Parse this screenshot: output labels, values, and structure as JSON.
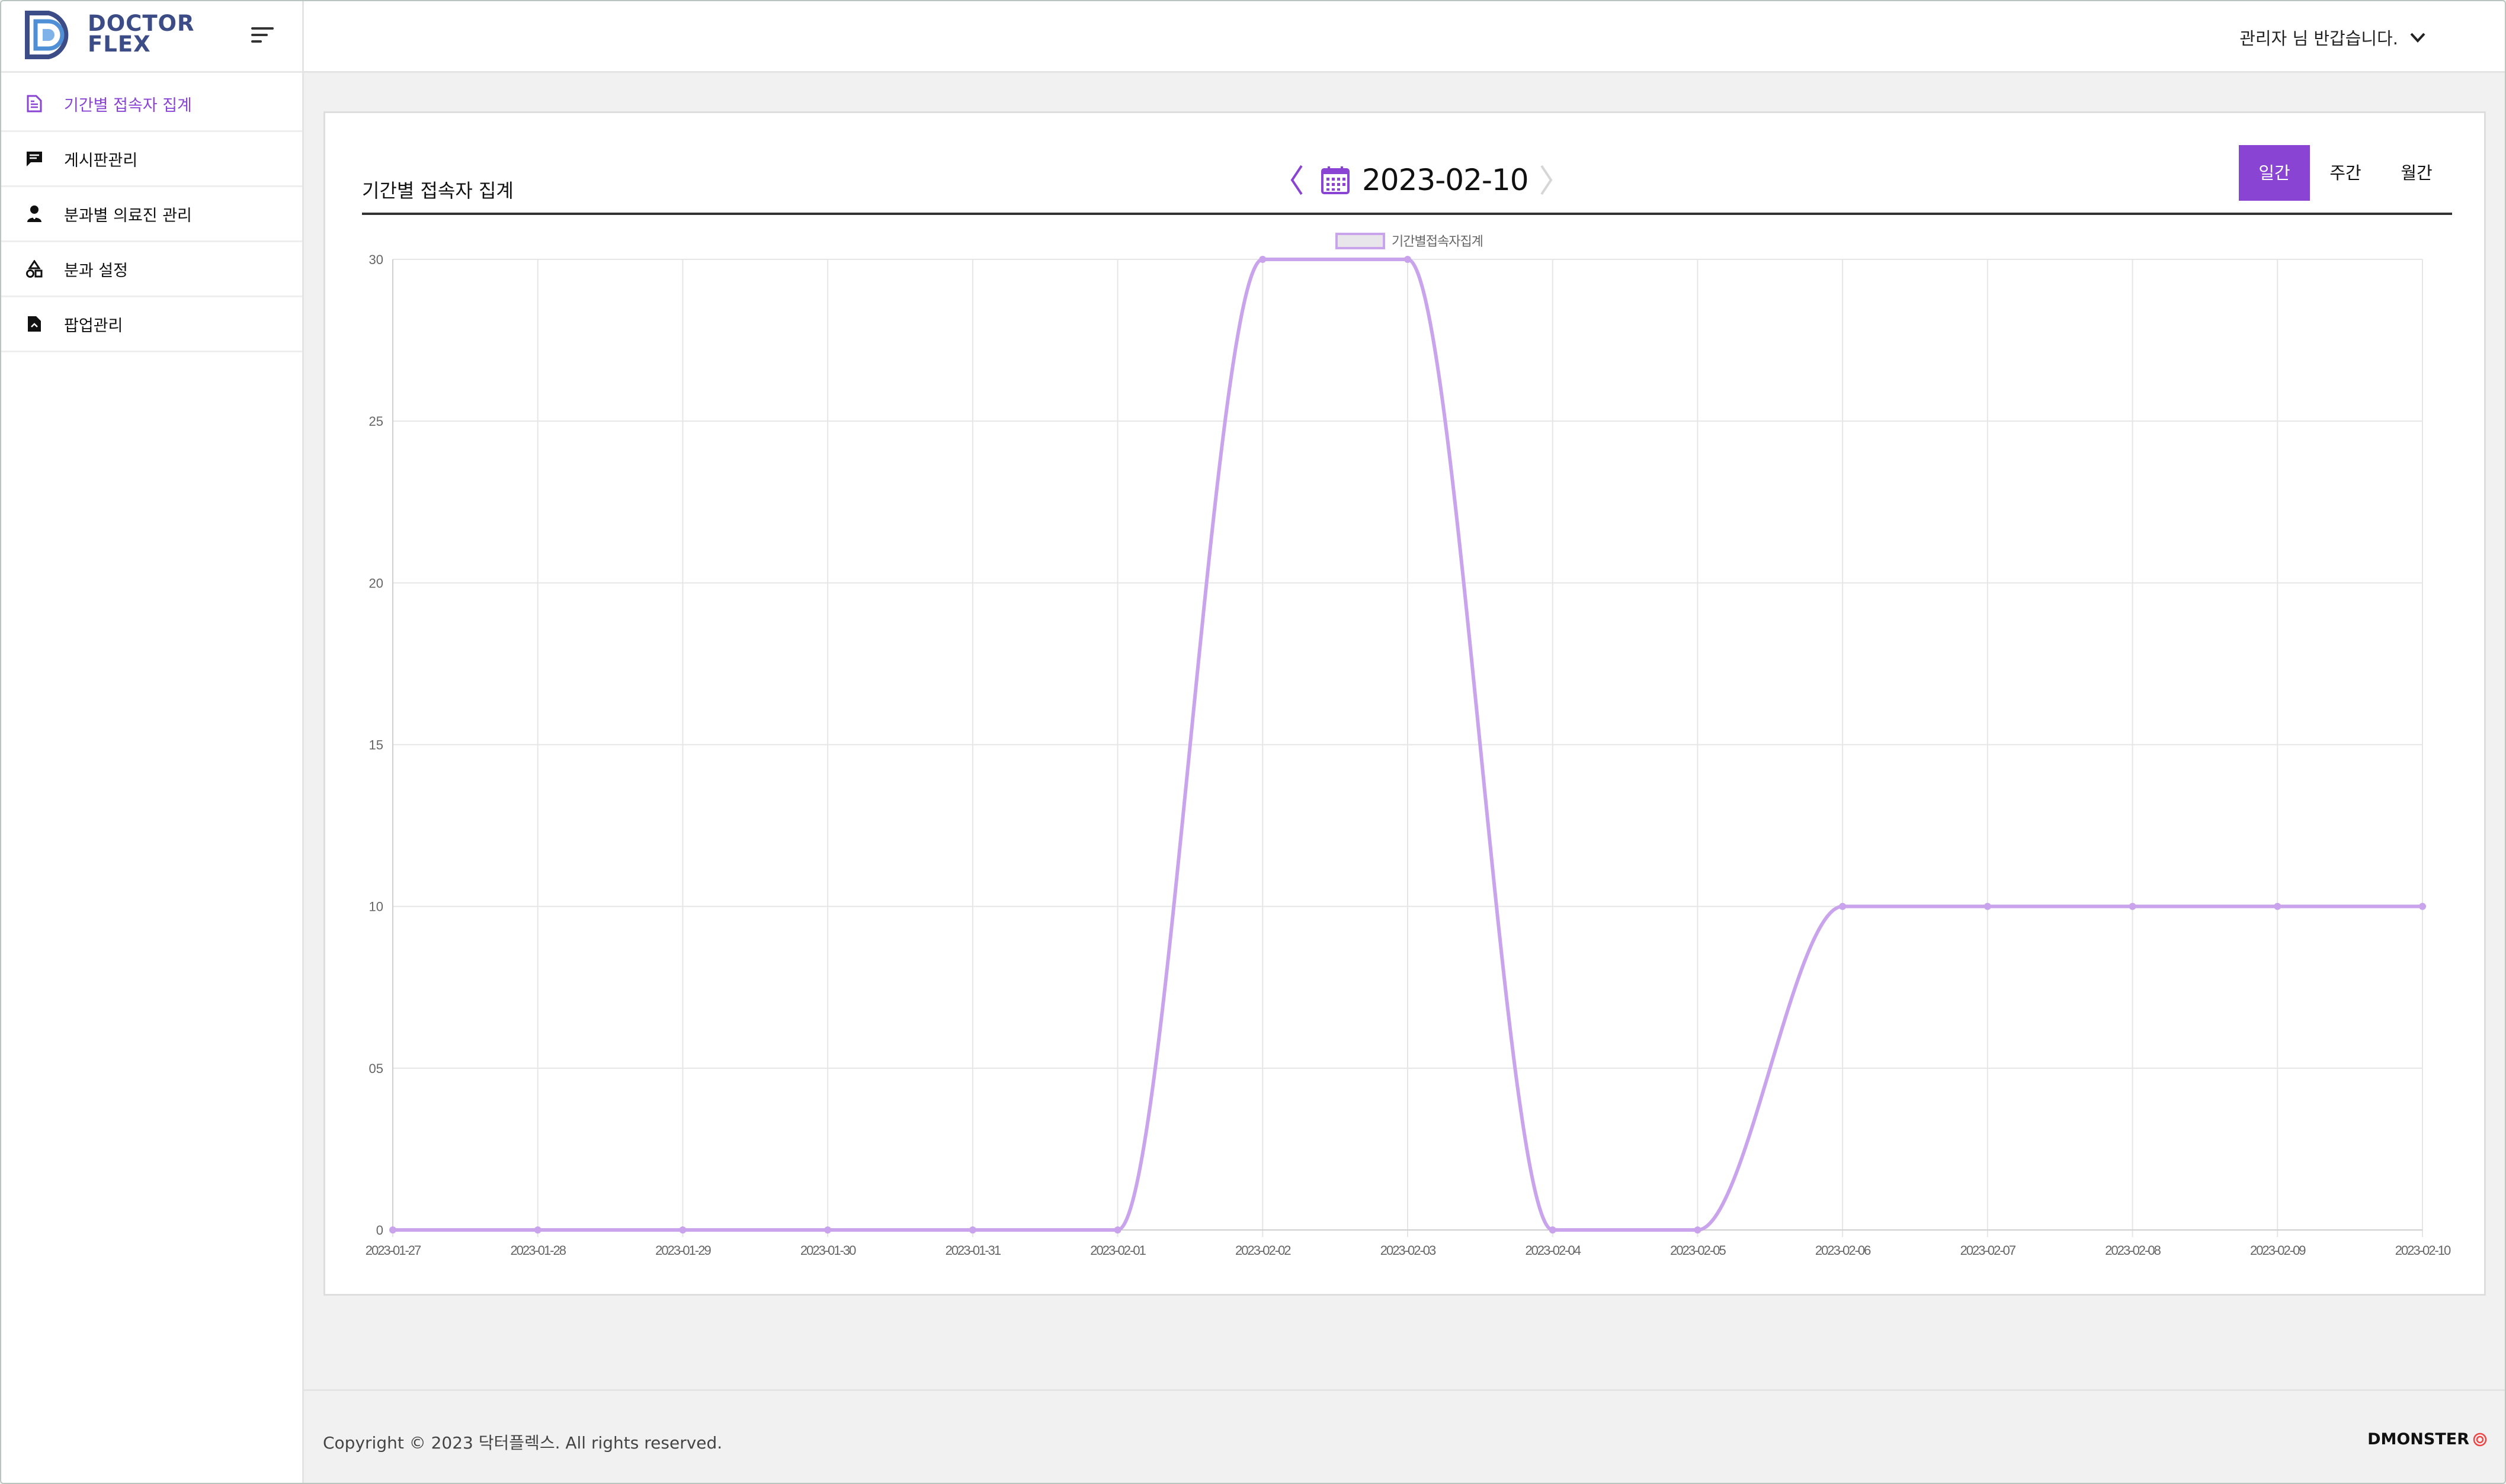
{
  "app": {
    "logo_line1": "DOCTOR",
    "logo_line2": "FLEX",
    "greeting": "관리자 님 반갑습니다.",
    "accent_color": "#8a44d4"
  },
  "sidebar": {
    "items": [
      {
        "label": "기간별 접속자 집계",
        "icon": "document-icon",
        "active": true
      },
      {
        "label": "게시판관리",
        "icon": "message-icon",
        "active": false
      },
      {
        "label": "분과별 의료진 관리",
        "icon": "doctor-icon",
        "active": false
      },
      {
        "label": "분과 설정",
        "icon": "shapes-icon",
        "active": false
      },
      {
        "label": "팝업관리",
        "icon": "popup-file-icon",
        "active": false
      }
    ]
  },
  "page": {
    "title": "기간별 접속자 집계",
    "date": "2023-02-10",
    "range_tabs": [
      "일간",
      "주간",
      "월간"
    ],
    "active_range": "일간"
  },
  "chart_data": {
    "type": "line",
    "x": [
      "2023-01-27",
      "2023-01-28",
      "2023-01-29",
      "2023-01-30",
      "2023-01-31",
      "2023-02-01",
      "2023-02-02",
      "2023-02-03",
      "2023-02-04",
      "2023-02-05",
      "2023-02-06",
      "2023-02-07",
      "2023-02-08",
      "2023-02-09",
      "2023-02-10"
    ],
    "series": [
      {
        "name": "기간별접속자집계",
        "values": [
          0,
          0,
          0,
          0,
          0,
          0,
          30,
          30,
          0,
          0,
          10,
          10,
          10,
          10,
          10
        ],
        "color": "#c9a4ec"
      }
    ],
    "y_ticks": [
      "0",
      "05",
      "10",
      "15",
      "20",
      "25",
      "30"
    ],
    "ylim": [
      0,
      30
    ],
    "grid": true,
    "legend": "top-center"
  },
  "footer": {
    "copyright": "Copyright © 2023 닥터플렉스. All rights reserved.",
    "brand": "DMONSTER"
  }
}
